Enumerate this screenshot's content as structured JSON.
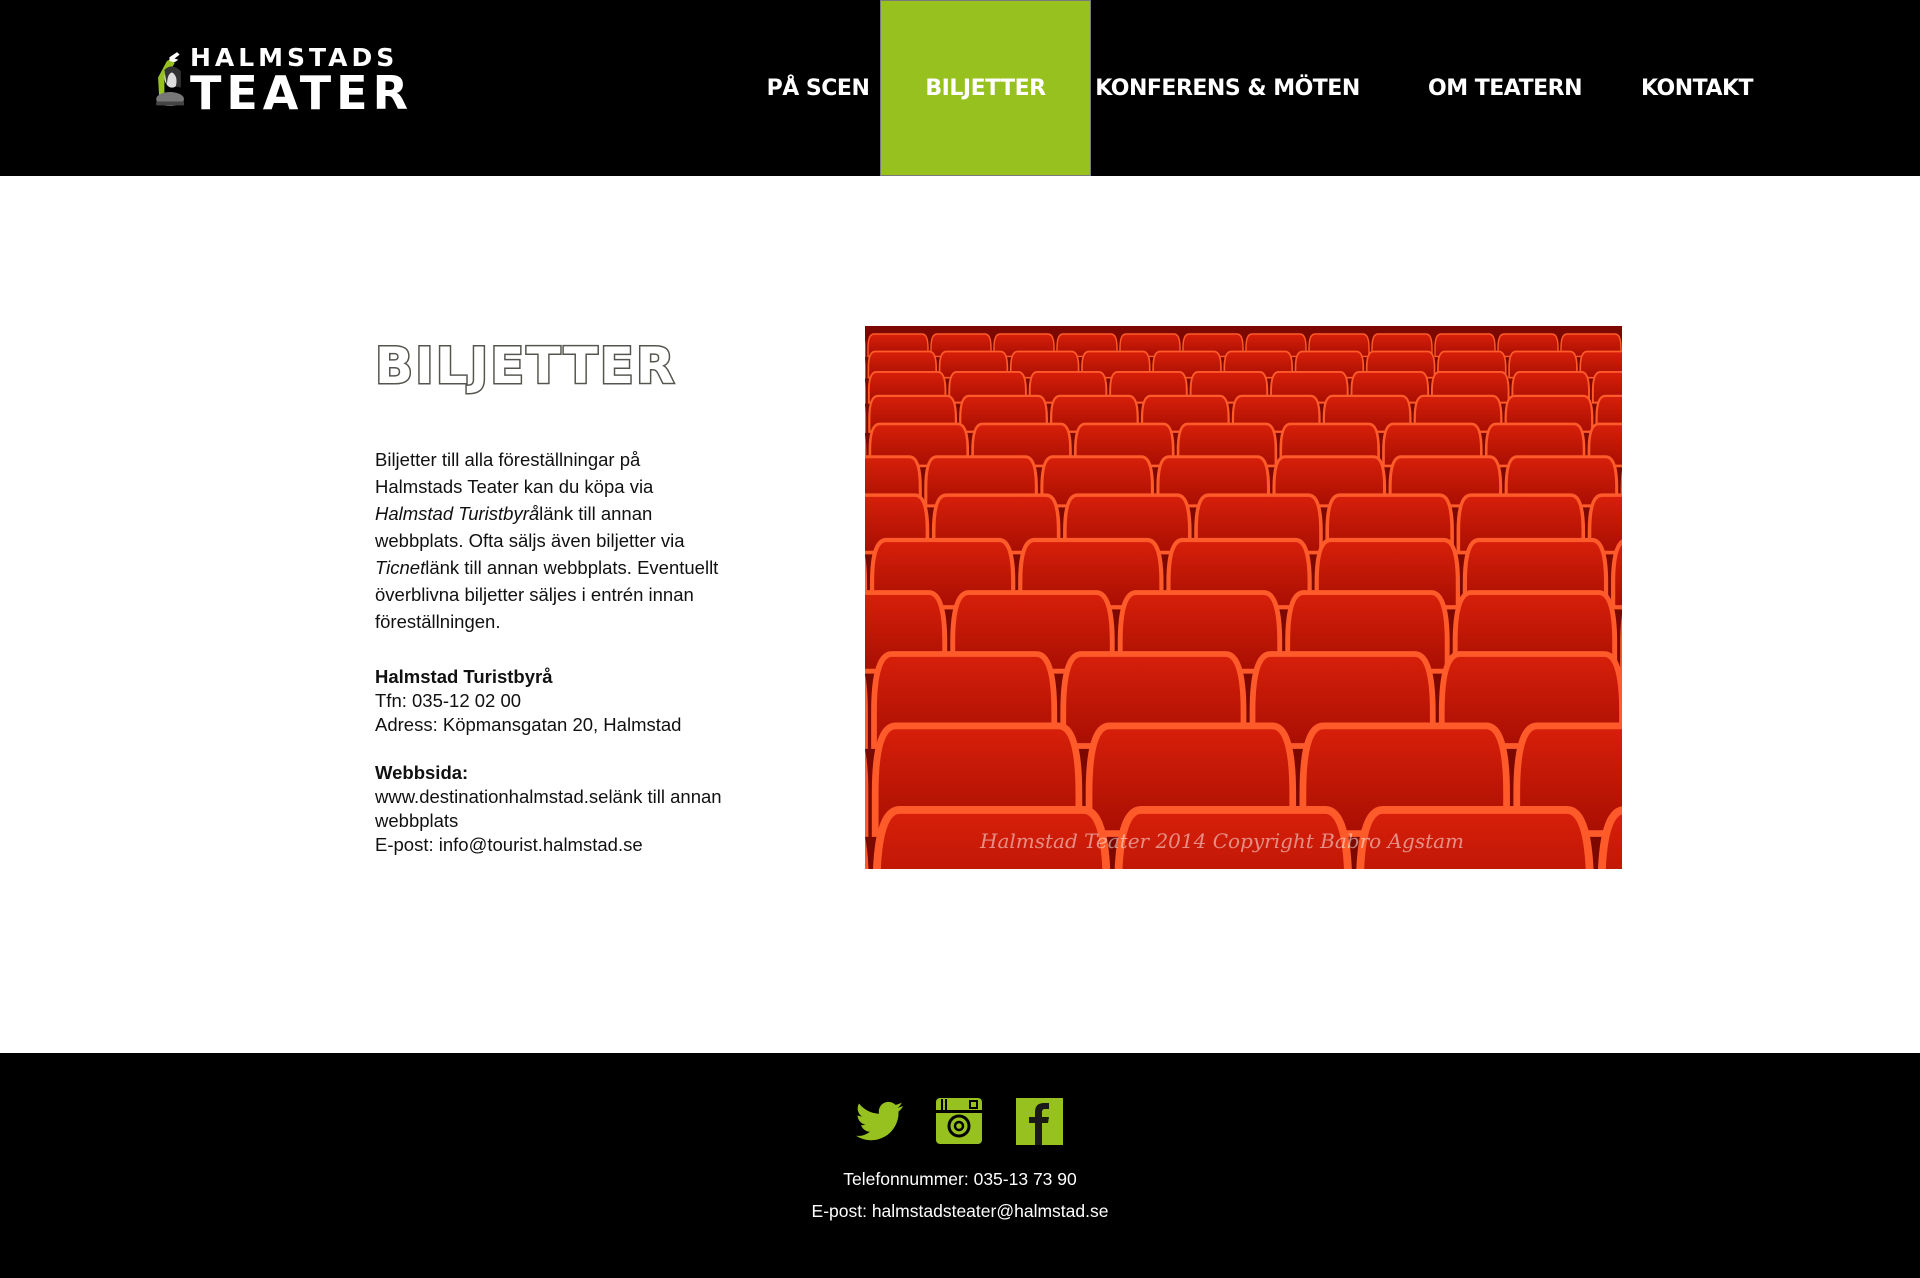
{
  "header": {
    "logo_line1": "HALMSTADS",
    "logo_line2": "TEATER",
    "nav": [
      {
        "label": "PÅ SCEN"
      },
      {
        "label": "BILJETTER",
        "active": true
      },
      {
        "label": "KONFERENS & MÖTEN"
      },
      {
        "label": "OM TEATERN"
      },
      {
        "label": "KONTAKT"
      }
    ]
  },
  "main": {
    "title": "BILJETTER",
    "intro": [
      "Biljetter till alla föreställningar på Halmstads Teater kan du köpa via ",
      "Halmstad Turistbyrå",
      "länk till annan webbplats",
      ". Ofta säljs även biljetter via ",
      "Ticnet",
      "länk till annan webbplats",
      ". Eventuellt överblivna biljetter säljes i entrén innan föreställningen."
    ],
    "contact_name": "Halmstad Turistbyrå",
    "phone": "Tfn: 035-12 02 00",
    "address": "Adress: Köpmansgatan 20, Halmstad",
    "web_label": "Webbsida:",
    "web_link": "www.destinationhalmstad.se",
    "web_suffix": "länk till annan webbplats",
    "email": "E-post: info@tourist.halmstad.se",
    "image_caption": "Halmstad Teater 2014 Copyright Babro Agstam"
  },
  "footer": {
    "phone_label": "Telefonnummer: ",
    "phone": "035-13 73 90",
    "email_label": "E-post: ",
    "email": "halmstadsteater@halmstad.se",
    "icons": [
      "twitter-icon",
      "instagram-icon",
      "facebook-icon"
    ]
  },
  "colors": {
    "accent": "#96c11f",
    "header_bg": "#000000",
    "title": "#555550"
  }
}
